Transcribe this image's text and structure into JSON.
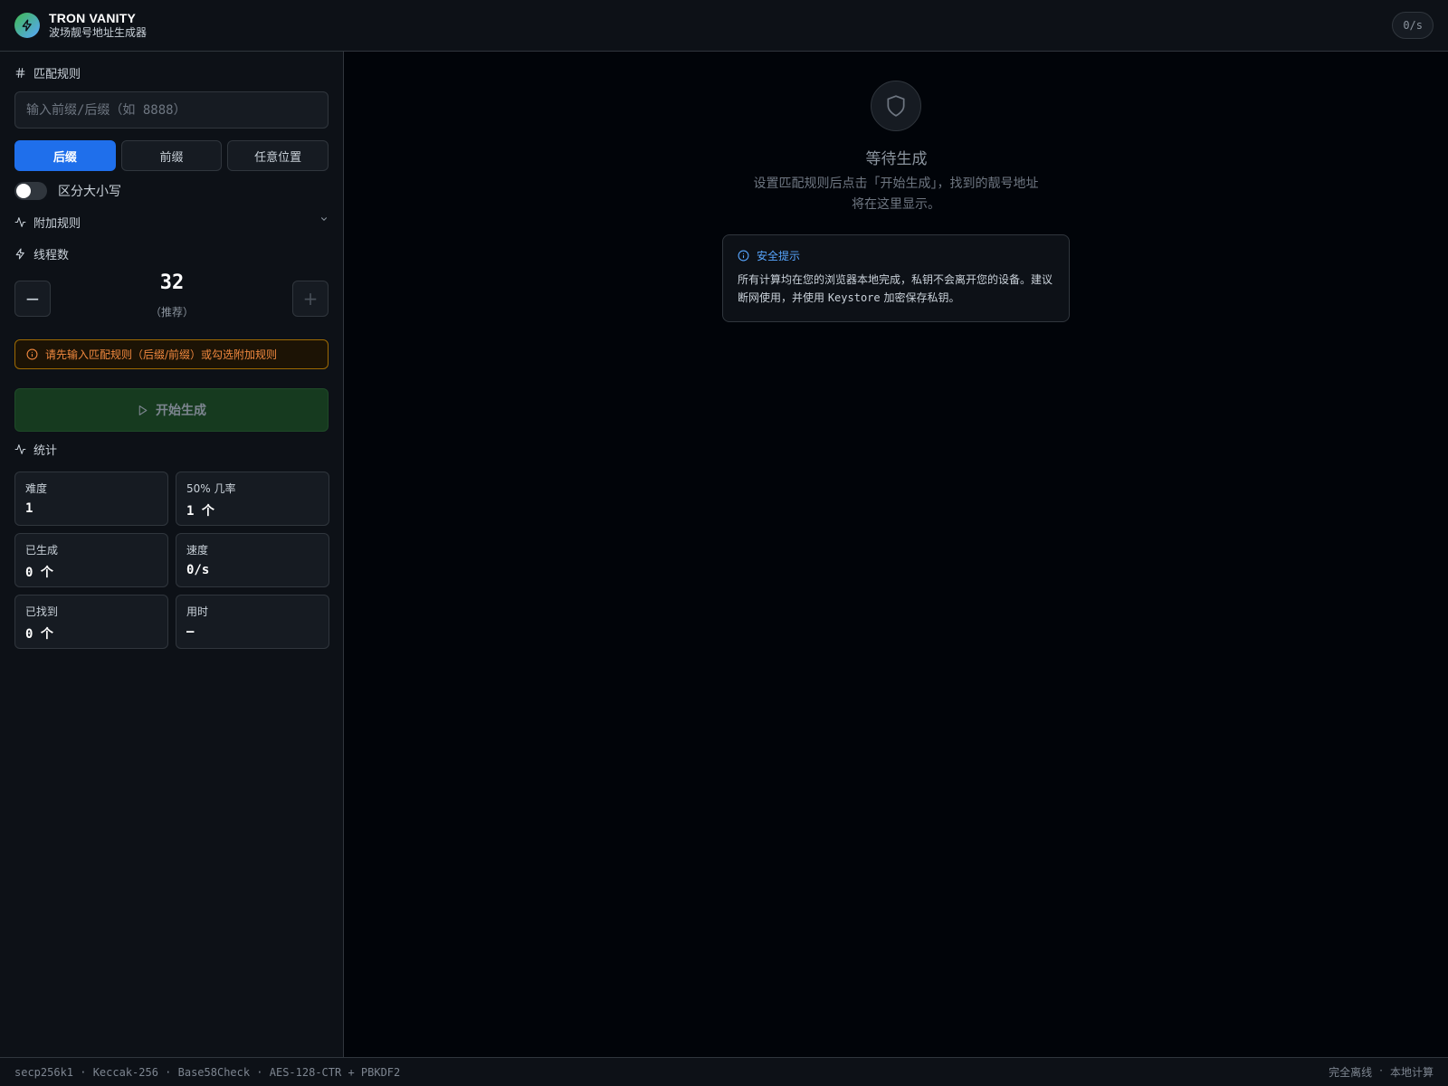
{
  "header": {
    "logo_icon": "lightning-icon",
    "title": "TRON VANITY",
    "subtitle": "波场靓号地址生成器",
    "rate": "0/s"
  },
  "sidebar": {
    "match_rules": {
      "icon": "hash-icon",
      "label": "匹配规则",
      "input_value": "",
      "input_placeholder": "输入前缀/后缀（如 8888）",
      "modes": [
        {
          "label": "后缀",
          "active": true
        },
        {
          "label": "前缀",
          "active": false
        },
        {
          "label": "任意位置",
          "active": false
        }
      ],
      "case_sensitive": {
        "label": "区分大小写",
        "enabled": false
      }
    },
    "extra_rules": {
      "icon": "activity-icon",
      "label": "附加规则",
      "expanded": false
    },
    "threads": {
      "icon": "lightning-icon",
      "label": "线程数",
      "value": "32",
      "hint": "（推荐）",
      "decrement": "−",
      "increment": "+"
    },
    "warning": {
      "icon": "info-icon",
      "text": "请先输入匹配规则（后缀/前缀）或勾选附加规则"
    },
    "start_button": {
      "icon": "play-icon",
      "label": "开始生成"
    },
    "stats": {
      "icon": "activity-icon",
      "label": "统计",
      "items": [
        {
          "label": "难度",
          "value": "1"
        },
        {
          "label": "50% 几率",
          "value": "1 个"
        },
        {
          "label": "已生成",
          "value": "0 个"
        },
        {
          "label": "速度",
          "value": "0/s"
        },
        {
          "label": "已找到",
          "value": "0 个"
        },
        {
          "label": "用时",
          "value": "—"
        }
      ]
    }
  },
  "main": {
    "empty_icon": "shield-icon",
    "empty_title": "等待生成",
    "empty_desc_line1": "设置匹配规则后点击「开始生成」，找到的靓号地址",
    "empty_desc_line2": "将在这里显示。",
    "notice": {
      "icon": "info-icon",
      "title": "安全提示",
      "body_line1": "所有计算均在您的浏览器本地完成，私钥不会离开您的设备。建议",
      "body_line2_pre": "断网使用，并使用 ",
      "body_line2_code": "Keystore",
      "body_line2_post": " 加密保存私钥。"
    }
  },
  "footer": {
    "algorithms": "secp256k1 · Keccak-256 · Base58Check · AES-128-CTR + PBKDF2",
    "badge_offline": "完全离线",
    "separator": "·",
    "badge_local": "本地计算"
  },
  "colors": {
    "accent": "#1f6feb",
    "warning": "#f0883e",
    "start": "#163a1f",
    "info": "#58a6ff"
  }
}
